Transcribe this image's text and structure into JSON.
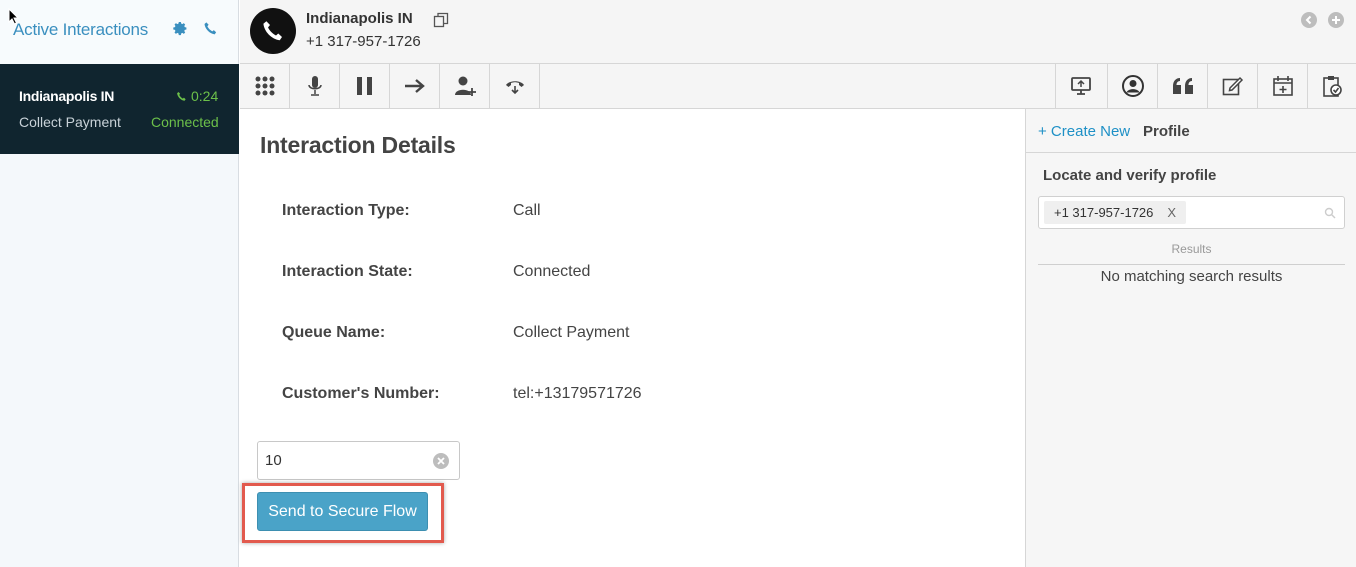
{
  "sidebar": {
    "title": "Active Interactions",
    "interaction": {
      "name": "Indianapolis IN",
      "queue": "Collect Payment",
      "time": "0:24",
      "status": "Connected"
    }
  },
  "header": {
    "name": "Indianapolis IN",
    "number": "+1 317-957-1726"
  },
  "toolbar": {
    "left_icons": [
      "dialpad-icon",
      "microphone-icon",
      "pause-icon",
      "transfer-icon",
      "add-participant-icon",
      "disconnect-icon"
    ],
    "right_icons": [
      "screen-share-icon",
      "profile-icon",
      "quote-icon",
      "edit-icon",
      "calendar-add-icon",
      "clipboard-check-icon"
    ]
  },
  "details": {
    "title": "Interaction Details",
    "rows": [
      {
        "label": "Interaction Type:",
        "value": "Call"
      },
      {
        "label": "Interaction State:",
        "value": "Connected"
      },
      {
        "label": "Queue Name:",
        "value": "Collect Payment"
      },
      {
        "label": "Customer's Number:",
        "value": "tel:+13179571726"
      }
    ],
    "input_value": "10",
    "button_label": "Send to Secure Flow"
  },
  "profile_panel": {
    "create_new": "+ Create New",
    "tab": "Profile",
    "locate_label": "Locate and verify profile",
    "search_tag": "+1 317-957-1726",
    "tag_remove": "X",
    "results_label": "Results",
    "no_results": "No matching search results"
  },
  "colors": {
    "accent": "#3a8fbf",
    "connected": "#6cc04a",
    "sidebar_card": "#10252f",
    "button": "#4aa3c8",
    "highlight": "#e25a4e"
  }
}
